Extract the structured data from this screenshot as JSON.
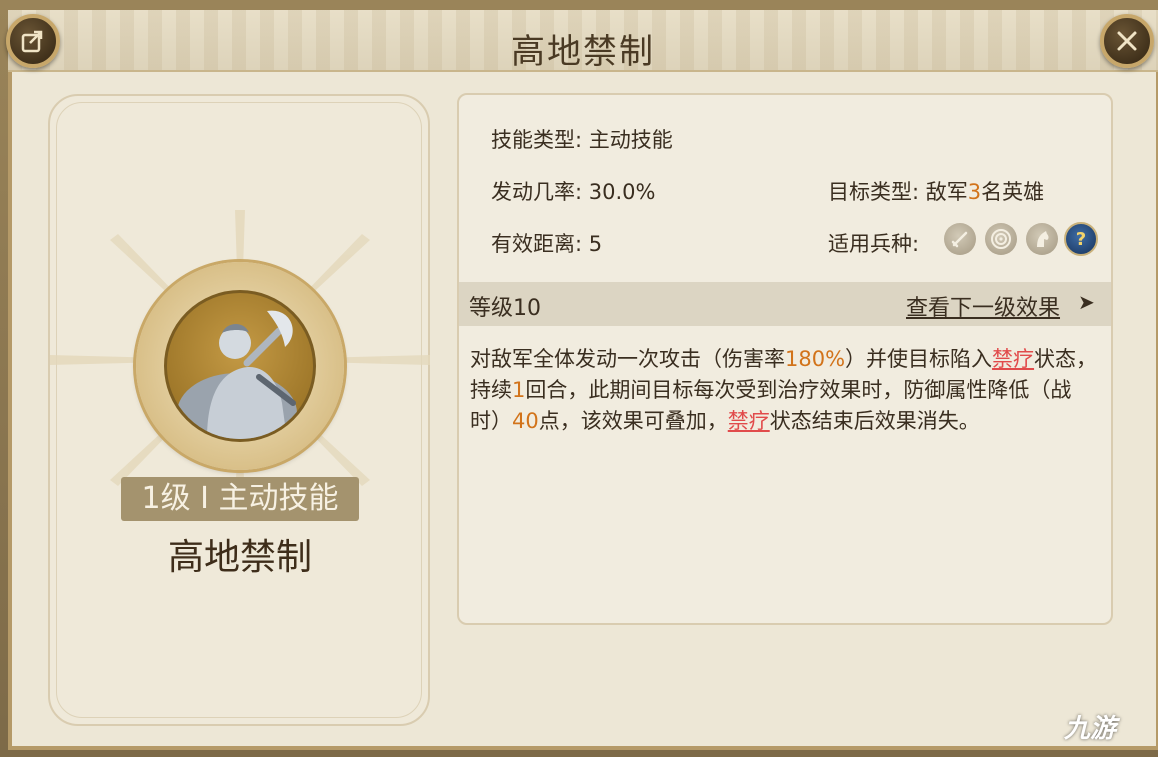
{
  "title": "高地禁制",
  "left": {
    "level_badge": "1级 I 主动技能",
    "skill_name": "高地禁制",
    "icon": "axe-warrior-icon"
  },
  "info": {
    "skill_type_label": "技能类型:",
    "skill_type_value": "主动技能",
    "trigger_rate_label": "发动几率:",
    "trigger_rate_value": "30.0%",
    "distance_label": "有效距离:",
    "distance_value": "5",
    "target_type_label": "目标类型:",
    "target_type_prefix": "敌军",
    "target_type_count": "3",
    "target_type_suffix": "名英雄",
    "troop_label": "适用兵种:",
    "troop_icons": [
      "sword-icon",
      "target-icon",
      "horse-icon",
      "question-icon"
    ],
    "troop_q": "?"
  },
  "level": {
    "label": "等级10",
    "next_link": "查看下一级效果",
    "arrow": "➤"
  },
  "description": {
    "p1": "对敌军全体发动一次攻击（伤害率",
    "rate": "180%",
    "p2": "）并使目标陷入",
    "status1": "禁疗",
    "p3": "状态，持续",
    "turns": "1",
    "p4": "回合，此期间目标每次受到治疗效果时，防御属性降低（战时）",
    "points": "40",
    "p5": "点，该效果可叠加，",
    "status2": "禁疗",
    "p6": "状态结束后效果消失。"
  },
  "watermark": "九游",
  "colors": {
    "accent_orange": "#d2731a",
    "status_red": "#e14b4b",
    "panel_bg": "#ede7d6"
  }
}
